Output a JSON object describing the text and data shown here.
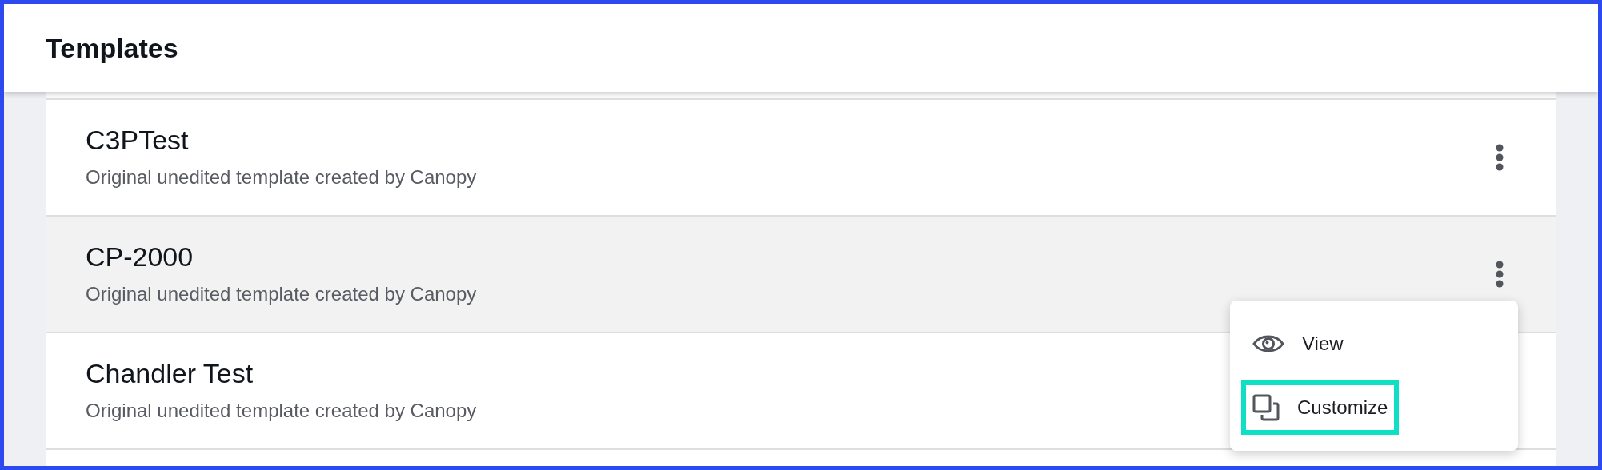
{
  "header": {
    "title": "Templates"
  },
  "templates": [
    {
      "name": "C3PTest",
      "description": "Original unedited template created by Canopy",
      "highlighted": false,
      "menu_open": false
    },
    {
      "name": "CP-2000",
      "description": "Original unedited template created by Canopy",
      "highlighted": true,
      "menu_open": true
    },
    {
      "name": "Chandler Test",
      "description": "Original unedited template created by Canopy",
      "highlighted": false,
      "menu_open": false
    }
  ],
  "menu": {
    "items": [
      {
        "kind": "view",
        "label": "View",
        "highlighted": false
      },
      {
        "kind": "customize",
        "label": "Customize",
        "highlighted": true
      }
    ]
  }
}
